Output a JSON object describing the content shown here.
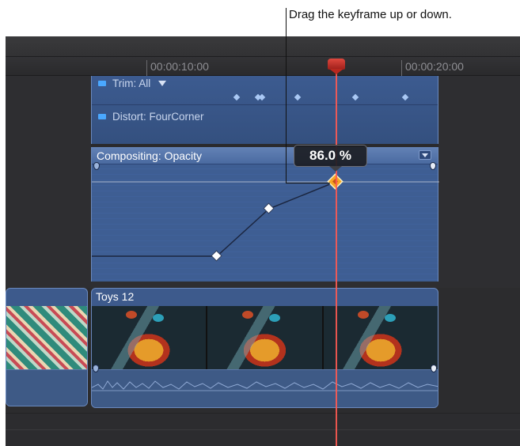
{
  "callout": {
    "text": "Drag the keyframe up or down."
  },
  "ruler": {
    "timecodes": [
      "00:00:10:00",
      "00:00:20:00"
    ]
  },
  "animation_editor": {
    "lanes": [
      {
        "label": "Trim: All",
        "has_disclosure": true
      },
      {
        "label": "Distort: FourCorner",
        "has_disclosure": false
      }
    ],
    "opacity_lane": {
      "title": "Compositing: Opacity"
    }
  },
  "keyframe_tooltip": {
    "value": "86.0 %"
  },
  "clips": [
    {
      "name": "Toys 12"
    }
  ],
  "colors": {
    "playhead": "#ff5a52",
    "selected_keyframe": "#f5a623",
    "lane_blue": "#3e5e93"
  },
  "icons": [
    "disclosure-triangle-icon",
    "keyframe-menu-icon",
    "playhead-icon",
    "keyframe-icon"
  ]
}
